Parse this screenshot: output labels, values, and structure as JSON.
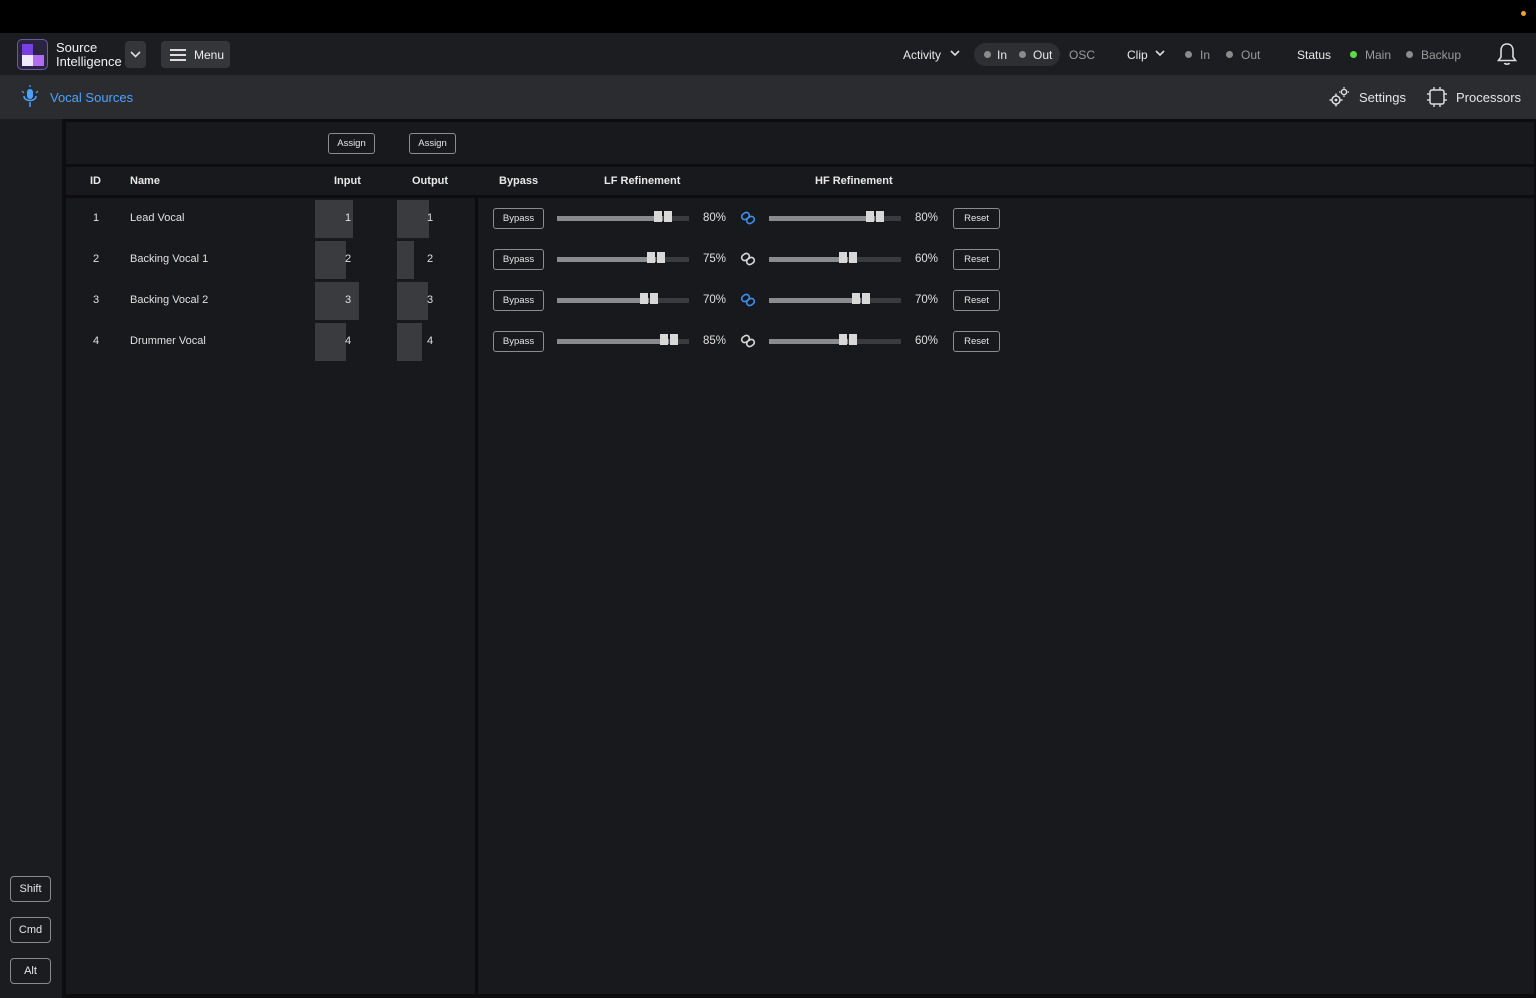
{
  "header": {
    "brand_line1": "Source",
    "brand_line2": "Intelligence",
    "menu_label": "Menu",
    "activity_label": "Activity",
    "activity_in": "In",
    "activity_out": "Out",
    "osc_label": "OSC",
    "clip_label": "Clip",
    "clip_in": "In",
    "clip_out": "Out",
    "status_label": "Status",
    "status_main": "Main",
    "status_backup": "Backup"
  },
  "subbar": {
    "title": "Vocal Sources",
    "settings_label": "Settings",
    "processors_label": "Processors"
  },
  "toolbar": {
    "assign_input_label": "Assign",
    "assign_output_label": "Assign"
  },
  "table": {
    "columns": {
      "id": "ID",
      "name": "Name",
      "input": "Input",
      "output": "Output",
      "bypass": "Bypass",
      "lf": "LF Refinement",
      "hf": "HF Refinement"
    },
    "rows": [
      {
        "id": "1",
        "name": "Lead Vocal",
        "input": "1",
        "output": "1",
        "input_level": 0.8,
        "output_level": 0.8,
        "bypass_label": "Bypass",
        "lf_value": 80,
        "lf_text": "80%",
        "linked": true,
        "hf_value": 80,
        "hf_text": "80%",
        "reset_label": "Reset"
      },
      {
        "id": "2",
        "name": "Backing Vocal 1",
        "input": "2",
        "output": "2",
        "input_level": 0.6,
        "output_level": 0.3,
        "bypass_label": "Bypass",
        "lf_value": 75,
        "lf_text": "75%",
        "linked": false,
        "hf_value": 60,
        "hf_text": "60%",
        "reset_label": "Reset"
      },
      {
        "id": "3",
        "name": "Backing Vocal 2",
        "input": "3",
        "output": "3",
        "input_level": 0.95,
        "output_level": 0.75,
        "bypass_label": "Bypass",
        "lf_value": 70,
        "lf_text": "70%",
        "linked": true,
        "hf_value": 70,
        "hf_text": "70%",
        "reset_label": "Reset"
      },
      {
        "id": "4",
        "name": "Drummer Vocal",
        "input": "4",
        "output": "4",
        "input_level": 0.6,
        "output_level": 0.55,
        "bypass_label": "Bypass",
        "lf_value": 85,
        "lf_text": "85%",
        "linked": false,
        "hf_value": 60,
        "hf_text": "60%",
        "reset_label": "Reset"
      }
    ]
  },
  "modifiers": {
    "shift": "Shift",
    "cmd": "Cmd",
    "alt": "Alt"
  },
  "colors": {
    "accent_blue": "#4aa3ff",
    "link_active": "#3d8ef0",
    "status_green": "#5ddc4a",
    "notify_orange": "#f0a030"
  },
  "icons": {
    "logo": "source-intelligence-logo",
    "menu": "hamburger-icon",
    "vocal": "microphone-icon",
    "settings": "gears-icon",
    "processors": "chip-icon",
    "notifications": "bell-icon",
    "link": "link-icon"
  }
}
